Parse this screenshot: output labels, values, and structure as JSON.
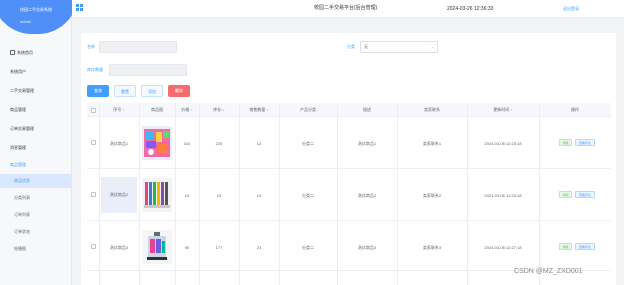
{
  "sidebar": {
    "title": "校园二手交易系统",
    "user": "admin",
    "items": [
      {
        "label": "系统首页",
        "type": "home"
      },
      {
        "label": "系统用户"
      },
      {
        "label": "二手交易管理"
      },
      {
        "label": "商品管理"
      },
      {
        "label": "订单交易管理"
      },
      {
        "label": "消息管理"
      },
      {
        "label": "商品管理",
        "state": "open"
      },
      {
        "label": "商品信息",
        "state": "active",
        "sub": true
      },
      {
        "label": "分类列表",
        "sub": true
      },
      {
        "label": "订单列表",
        "sub": true
      },
      {
        "label": "订单状态",
        "sub": true
      },
      {
        "label": "轮播图",
        "sub": true
      }
    ]
  },
  "header": {
    "title": "校园二手交易平台(后台管理)",
    "datetime": "2024-03-26 12:36:33",
    "logout": "退出登录"
  },
  "filters": {
    "name_label": "名称",
    "category_label": "分类",
    "category_value": "无",
    "stock_label": "库存数量"
  },
  "buttons": {
    "search": "查询",
    "reset": "重置",
    "add": "添加",
    "delete": "删除"
  },
  "table": {
    "headers": [
      "序号",
      "商品图",
      "价格",
      "库存",
      "销售数量",
      "产品分类",
      "描述",
      "卖家联系",
      "更新时间",
      "操作"
    ],
    "rows": [
      {
        "name": "测试商品1",
        "price": "310",
        "stock": "220",
        "sales": "13",
        "category": "分类二",
        "desc": "测试商品1",
        "contact": "卖家联系1",
        "time": "2024-03-06 12:23:18",
        "thumb": "toy"
      },
      {
        "name": "测试商品2",
        "price": "10",
        "stock": "23",
        "sales": "13",
        "category": "分类二",
        "desc": "测试商品2",
        "contact": "卖家联系2",
        "time": "2024-03-06 12:23:18",
        "thumb": "pens"
      },
      {
        "name": "测试商品3",
        "price": "90",
        "stock": "177",
        "sales": "23",
        "category": "分类二",
        "desc": "测试商品3",
        "contact": "卖家联系3",
        "time": "2024-03-06 12:27:18",
        "thumb": "box"
      }
    ],
    "op_detail": "详情",
    "op_edit": "查看评论"
  },
  "watermark": "CSDN @MZ_ZXD001",
  "colors": {
    "primary": "#409eff",
    "danger": "#f56c6c",
    "success": "#67c23a",
    "sidebar_header": "#4f8ff7"
  }
}
